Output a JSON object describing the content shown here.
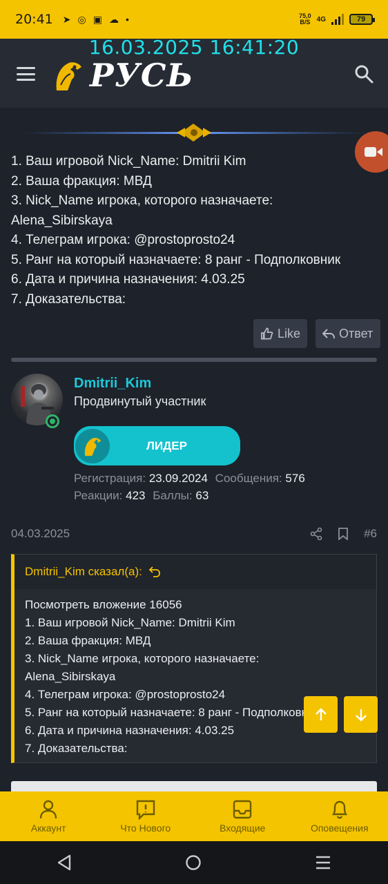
{
  "status_bar": {
    "time": "20:41",
    "net_speed_value": "75,0",
    "net_speed_unit": "B/S",
    "network": "4G",
    "battery": "79"
  },
  "overlay_timestamp": "16.03.2025 16:41:20",
  "header": {
    "logo_text": "РУСЬ"
  },
  "previous_post": {
    "lines": [
      "1. Ваш игровой Nick_Name: Dmitrii Kim",
      "2. Ваша фракция: МВД",
      "3. Nick_Name игрока, которого назначаете:",
      "Alena_Sibirskaya",
      "4. Телеграм игрока: @prostoprosto24",
      "5. Ранг на который назначаете: 8 ранг - Подполковник",
      "6. Дата и причина назначения: 4.03.25",
      "7. Доказательства:"
    ],
    "like_label": "Like",
    "reply_label": "Ответ"
  },
  "author": {
    "name": "Dmitrii_Kim",
    "title": "Продвинутый участник",
    "banner": "ЛИДЕР",
    "reg_label": "Регистрация:",
    "reg_value": "23.09.2024",
    "msgs_label": "Сообщения:",
    "msgs_value": "576",
    "reactions_label": "Реакции:",
    "reactions_value": "423",
    "points_label": "Баллы:",
    "points_value": "63"
  },
  "post": {
    "date": "04.03.2025",
    "number": "#6",
    "quote_header": "Dmitrii_Kim сказал(а):",
    "quote_lines": [
      "Посмотреть вложение 16056",
      "1. Ваш игровой Nick_Name: Dmitrii Kim",
      "2. Ваша фракция: МВД",
      "3. Nick_Name игрока, которого назначаете:",
      "Alena_Sibirskaya",
      "4. Телеграм игрока: @prostoprosto24",
      "5. Ранг на который назначаете: 8 ранг - Подполковник",
      "6. Дата и причина назначения: 4.03.25",
      "7. Доказательства:"
    ]
  },
  "bottom_nav": [
    {
      "label": "Аккаунт",
      "icon": "person-icon"
    },
    {
      "label": "Что Нового",
      "icon": "news-icon"
    },
    {
      "label": "Входящие",
      "icon": "inbox-icon"
    },
    {
      "label": "Оповещения",
      "icon": "bell-icon"
    }
  ],
  "colors": {
    "accent": "#f5c400",
    "username": "#1ec7d8",
    "background": "#1e222a",
    "timestamp_overlay": "#21e0e8"
  }
}
